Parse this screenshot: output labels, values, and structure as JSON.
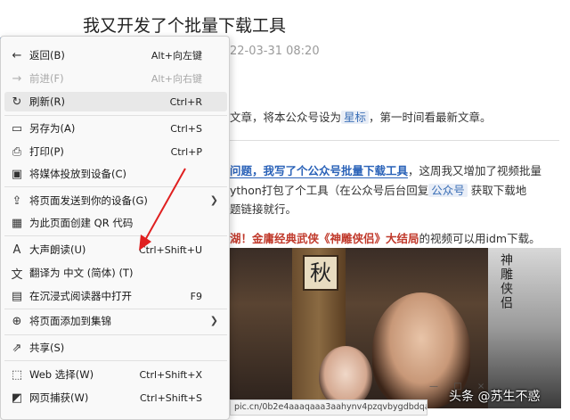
{
  "article": {
    "title": "我又开发了个批量下载工具",
    "date": "22-03-31 08:20",
    "line1_prefix": "文章，将本公众号设为",
    "line1_tag": "星标",
    "line1_suffix": "，第一时间看最新文章。",
    "line2_link": "问题，我写了个公众号批量下载工具",
    "line2_suffix": "，这周我又增加了视频批量",
    "line3_prefix": "ython打包了个工具（在公众号后台回复",
    "line3_tag": "公众号",
    "line3_suffix": "获取下载地",
    "line4": "题链接就行。",
    "line5_link": "湖！金庸经典武侠《神雕侠侣》大结局",
    "line5_suffix": "的视频可以用idm下载。",
    "url_bar": "pic.cn/0b2e4aaaqaaa3aahynv4pzqvbygdbdqacaa.f10002.mp",
    "watermark": "头条 @苏生不惑",
    "video_sign": "秋",
    "video_poster_text": "神雕侠侣",
    "mini_controls": [
      "—",
      "□",
      "×"
    ]
  },
  "menu": {
    "items": [
      {
        "icon": "←",
        "label": "返回(B)",
        "shortcut": "Alt+向左键",
        "disabled": false
      },
      {
        "icon": "→",
        "label": "前进(F)",
        "shortcut": "Alt+向右键",
        "disabled": true
      },
      {
        "icon": "↻",
        "label": "刷新(R)",
        "shortcut": "Ctrl+R",
        "disabled": false
      },
      {
        "icon": "▭",
        "label": "另存为(A)",
        "shortcut": "Ctrl+S",
        "disabled": false
      },
      {
        "icon": "⎙",
        "label": "打印(P)",
        "shortcut": "Ctrl+P",
        "disabled": false
      },
      {
        "icon": "▣",
        "label": "将媒体投放到设备(C)",
        "shortcut": "",
        "disabled": false
      },
      {
        "icon": "⇪",
        "label": "将页面发送到你的设备(G)",
        "shortcut": "",
        "disabled": false,
        "submenu": true
      },
      {
        "icon": "▦",
        "label": "为此页面创建 QR 代码",
        "shortcut": "",
        "disabled": false
      },
      {
        "icon": "A",
        "label": "大声朗读(U)",
        "shortcut": "Ctrl+Shift+U",
        "disabled": false
      },
      {
        "icon": "文",
        "label": "翻译为 中文 (简体) (T)",
        "shortcut": "",
        "disabled": false
      },
      {
        "icon": "▤",
        "label": "在沉浸式阅读器中打开",
        "shortcut": "F9",
        "disabled": false
      },
      {
        "icon": "⊕",
        "label": "将页面添加到集锦",
        "shortcut": "",
        "disabled": false,
        "submenu": true
      },
      {
        "icon": "⇗",
        "label": "共享(S)",
        "shortcut": "",
        "disabled": false
      },
      {
        "icon": "⬚",
        "label": "Web 选择(W)",
        "shortcut": "Ctrl+Shift+X",
        "disabled": false
      },
      {
        "icon": "◩",
        "label": "网页捕获(W)",
        "shortcut": "Ctrl+Shift+S",
        "disabled": false
      }
    ]
  },
  "colors": {
    "accent": "#1e6fd9",
    "annotation_arrow": "#e02020",
    "link_blue": "#2a62b8",
    "link_red": "#c0392b"
  }
}
